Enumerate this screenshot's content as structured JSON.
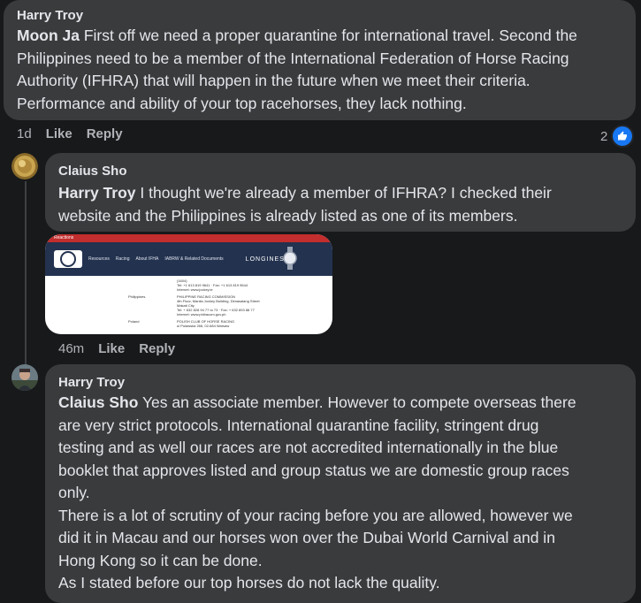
{
  "comment1": {
    "author": "Harry Troy",
    "mention": "Moon Ja",
    "lines": [
      " First off we need a proper quarantine for international travel. Second the",
      "Philippines need to be a member of the International Federation of Horse Racing",
      "Authority (IFHRA) that will happen in the future when we meet their criteria.",
      "Performance and ability of your top racehorses, they lack nothing."
    ],
    "time": "1d",
    "like": "Like",
    "reply": "Reply",
    "reaction_count": "2",
    "reaction_icon": "like-icon"
  },
  "comment2": {
    "author": "Claius Sho",
    "mention": "Harry Troy",
    "lines": [
      " I thought we're already a member of IFHRA? I checked their",
      "website and the Philippines is already listed as one of its members."
    ],
    "time": "46m",
    "like": "Like",
    "reply": "Reply"
  },
  "screenshot": {
    "browser_bar": "Reactions",
    "nav_items": [
      "Resources",
      "Racing",
      "About IFHA",
      "IABRW & Related Documents"
    ],
    "brand": "LONGINES",
    "rows": [
      {
        "country": "",
        "lines": [
          "(1604)",
          "Tel: +1 613 819 9641 · Fax: +1 613 819 9644",
          "Internet: www.jockey.ie"
        ]
      },
      {
        "country": "Philippines",
        "lines": [
          "PHILIPPINE RACING COMMISSION",
          "4th Floor, Manila Jockey Building, Dimasalang Street",
          "Makati City",
          "Tel: + 632 828 94 77 to 73 · Fax: + 632 893 88 77",
          "Internet: www.philracom.gov.ph"
        ]
      },
      {
        "country": "Poland",
        "lines": [
          "POLISH CLUB OF HORSE RACING",
          "ul Pulawska 266, 02-684 Warsaw"
        ]
      }
    ]
  },
  "comment3": {
    "author": "Harry Troy",
    "mention": "Claius Sho",
    "lines": [
      " Yes an associate member. However to compete overseas there",
      "are very strict protocols. International quarantine facility, stringent drug",
      "testing and as well our races are not accredited internationally in the blue",
      "booklet that approves listed and group status we are domestic group races",
      "only.",
      "There is a lot of scrutiny of your racing before you are allowed, however we",
      "did it in Macau and our horses won over the Dubai World Carnival and in",
      "Hong Kong so it can be done.",
      "As I stated before our top horses do not lack the quality."
    ]
  },
  "colors": {
    "background": "#18191a",
    "bubble": "#3a3b3c",
    "text": "#e4e6eb",
    "secondary": "#b0b3b8",
    "like_blue": "#1877f2"
  }
}
